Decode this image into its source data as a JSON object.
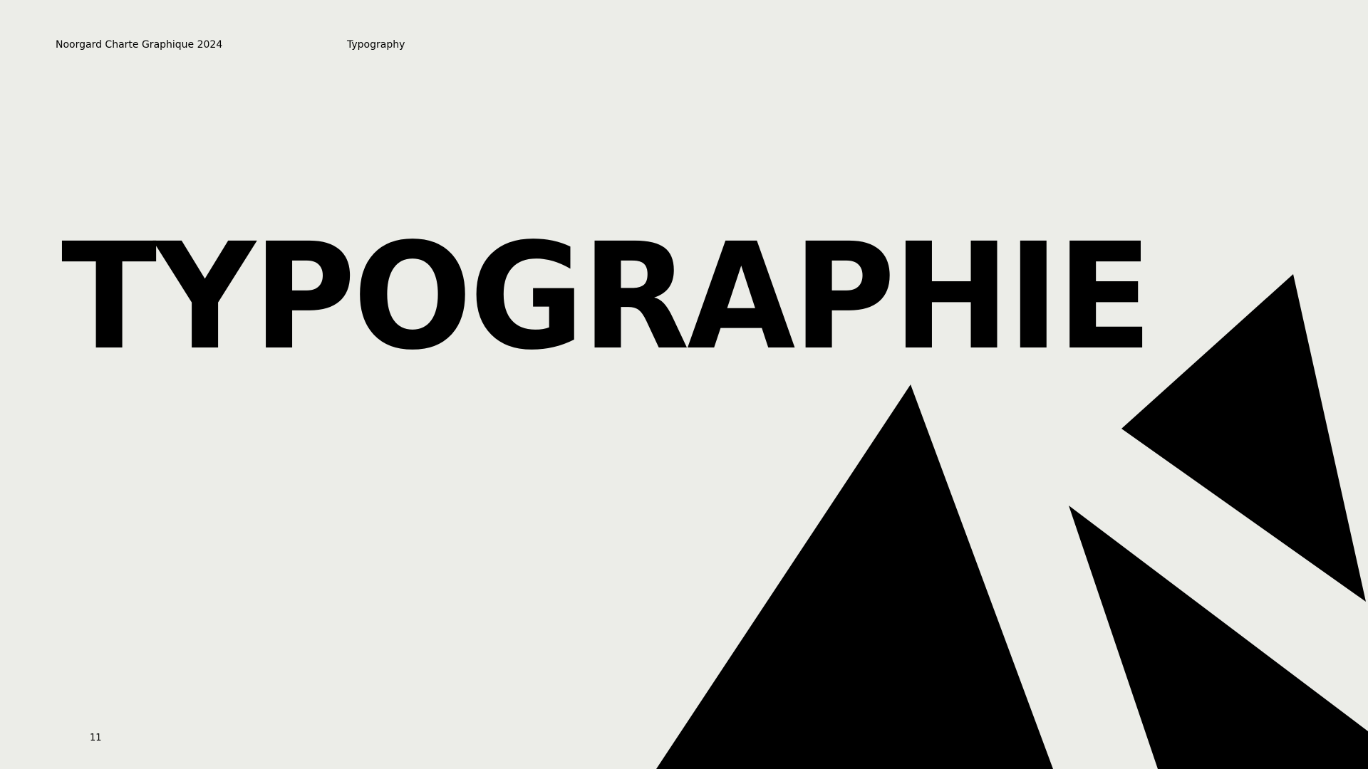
{
  "colors": {
    "background": "#ECEDE8",
    "ink": "#000000"
  },
  "header": {
    "brand": "Noorgard Charte Graphique 2024",
    "section": "Typography"
  },
  "hero": {
    "title": "TYPOGRAPHIE"
  },
  "footer": {
    "page_number": "11"
  },
  "decor": {
    "shape_count": 3,
    "shape_type": "triangle"
  }
}
